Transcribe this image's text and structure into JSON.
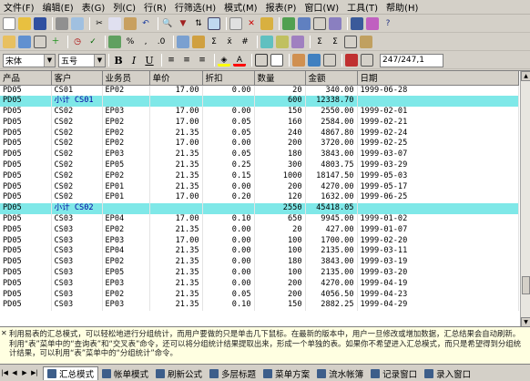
{
  "menu": [
    "文件(F)",
    "编辑(E)",
    "表(G)",
    "列(C)",
    "行(R)",
    "行筛选(H)",
    "模式(M)",
    "报表(P)",
    "窗口(W)",
    "工具(T)",
    "帮助(H)"
  ],
  "font": {
    "name": "宋体",
    "size": "五号"
  },
  "counter": "247/247,1",
  "table": {
    "headers": [
      "产品",
      "客户",
      "业务员",
      "单价",
      "折扣",
      "数量",
      "金额",
      "日期"
    ],
    "rows": [
      {
        "type": "data",
        "cells": [
          "PD05",
          "CS01",
          "EP02",
          "17.00",
          "0.00",
          "20",
          "340.00",
          "1999-06-28"
        ]
      },
      {
        "type": "subtotal",
        "cells": [
          "PD05",
          "小计 CS01",
          "",
          "",
          "",
          "600",
          "12338.70",
          ""
        ]
      },
      {
        "type": "data",
        "cells": [
          "PD05",
          "CS02",
          "EP03",
          "17.00",
          "0.00",
          "150",
          "2550.00",
          "1999-02-01"
        ]
      },
      {
        "type": "data",
        "cells": [
          "PD05",
          "CS02",
          "EP02",
          "17.00",
          "0.05",
          "160",
          "2584.00",
          "1999-02-21"
        ]
      },
      {
        "type": "data",
        "cells": [
          "PD05",
          "CS02",
          "EP02",
          "21.35",
          "0.05",
          "240",
          "4867.80",
          "1999-02-24"
        ]
      },
      {
        "type": "data",
        "cells": [
          "PD05",
          "CS02",
          "EP02",
          "17.00",
          "0.00",
          "200",
          "3720.00",
          "1999-02-25"
        ]
      },
      {
        "type": "data",
        "cells": [
          "PD05",
          "CS02",
          "EP03",
          "21.35",
          "0.05",
          "180",
          "3843.00",
          "1999-03-07"
        ]
      },
      {
        "type": "data",
        "cells": [
          "PD05",
          "CS02",
          "EP05",
          "21.35",
          "0.25",
          "300",
          "4803.75",
          "1999-03-29"
        ]
      },
      {
        "type": "data",
        "cells": [
          "PD05",
          "CS02",
          "EP02",
          "21.35",
          "0.15",
          "1000",
          "18147.50",
          "1999-05-03"
        ]
      },
      {
        "type": "data",
        "cells": [
          "PD05",
          "CS02",
          "EP01",
          "21.35",
          "0.00",
          "200",
          "4270.00",
          "1999-05-17"
        ]
      },
      {
        "type": "data",
        "cells": [
          "PD05",
          "CS02",
          "EP01",
          "17.00",
          "0.20",
          "120",
          "1632.00",
          "1999-06-25"
        ]
      },
      {
        "type": "subtotal",
        "cells": [
          "PD05",
          "小计 CS02",
          "",
          "",
          "",
          "2550",
          "45418.05",
          ""
        ]
      },
      {
        "type": "data",
        "cells": [
          "PD05",
          "CS03",
          "EP04",
          "17.00",
          "0.10",
          "650",
          "9945.00",
          "1999-01-02"
        ]
      },
      {
        "type": "data",
        "cells": [
          "PD05",
          "CS03",
          "EP02",
          "21.35",
          "0.00",
          "20",
          "427.00",
          "1999-01-07"
        ]
      },
      {
        "type": "data",
        "cells": [
          "PD05",
          "CS03",
          "EP03",
          "17.00",
          "0.00",
          "100",
          "1700.00",
          "1999-02-20"
        ]
      },
      {
        "type": "data",
        "cells": [
          "PD05",
          "CS03",
          "EP04",
          "21.35",
          "0.00",
          "100",
          "2135.00",
          "1999-03-11"
        ]
      },
      {
        "type": "data",
        "cells": [
          "PD05",
          "CS03",
          "EP02",
          "21.35",
          "0.00",
          "180",
          "3843.00",
          "1999-03-19"
        ]
      },
      {
        "type": "data",
        "cells": [
          "PD05",
          "CS03",
          "EP05",
          "21.35",
          "0.00",
          "100",
          "2135.00",
          "1999-03-20"
        ]
      },
      {
        "type": "data",
        "cells": [
          "PD05",
          "CS03",
          "EP03",
          "21.35",
          "0.00",
          "200",
          "4270.00",
          "1999-04-19"
        ]
      },
      {
        "type": "data",
        "cells": [
          "PD05",
          "CS03",
          "EP02",
          "21.35",
          "0.05",
          "200",
          "4056.50",
          "1999-04-23"
        ]
      },
      {
        "type": "data",
        "cells": [
          "PD05",
          "CS03",
          "EP03",
          "21.35",
          "0.10",
          "150",
          "2882.25",
          "1999-04-29"
        ]
      }
    ]
  },
  "help_text": "利用易表的汇总模式，可以轻松地进行分组统计，而用户要做的只是单击几下鼠标。在最新的版本中，用户一旦修改或增加数据，汇总结果会自动刷新。利用“表”菜单中的“查询表”和“交叉表”命令，还可以将分组统计结果提取出来，形成一个单独的表。如果你不希望进入汇总模式，而只是希望得到分组统计结果，可以利用“表”菜单中的“分组统计”命令。",
  "tabs": [
    "汇总模式",
    "帐单模式",
    "刷新公式",
    "多层标题",
    "菜单方案",
    "流水帐簿",
    "记录窗口",
    "录入窗口"
  ],
  "active_tab": 0
}
